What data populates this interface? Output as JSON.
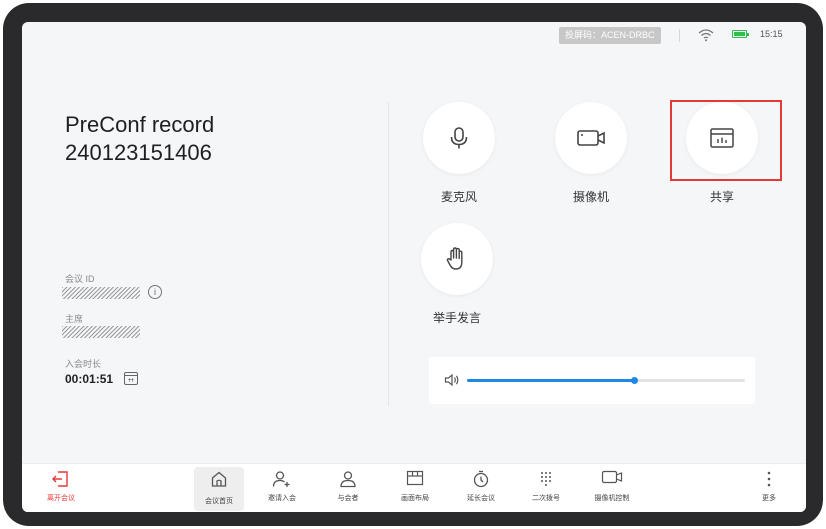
{
  "status_bar": {
    "cast_code": "投屏码：ACEN-DRBC",
    "time": "15:15",
    "battery_color": "#2fbf4a"
  },
  "meeting": {
    "title_line1": "PreConf record",
    "title_line2": "240123151406",
    "id_label": "会议 ID",
    "host_label": "主席",
    "duration_label": "入会时长",
    "duration": "00:01:51"
  },
  "controls": {
    "mic": "麦克风",
    "camera": "摄像机",
    "share": "共享",
    "raise_hand": "举手发言"
  },
  "volume": {
    "level": 0.6,
    "accent": "#1e88e5"
  },
  "toolbar": {
    "leave": "离开会议",
    "home": "会议首页",
    "invite": "邀请入会",
    "participants": "与会者",
    "layout": "画面布局",
    "extend": "延长会议",
    "dial": "二次拨号",
    "camera_control": "摄像机控制",
    "more": "更多"
  },
  "colors": {
    "accent_red": "#e53935",
    "background": "#f5f6f8"
  }
}
